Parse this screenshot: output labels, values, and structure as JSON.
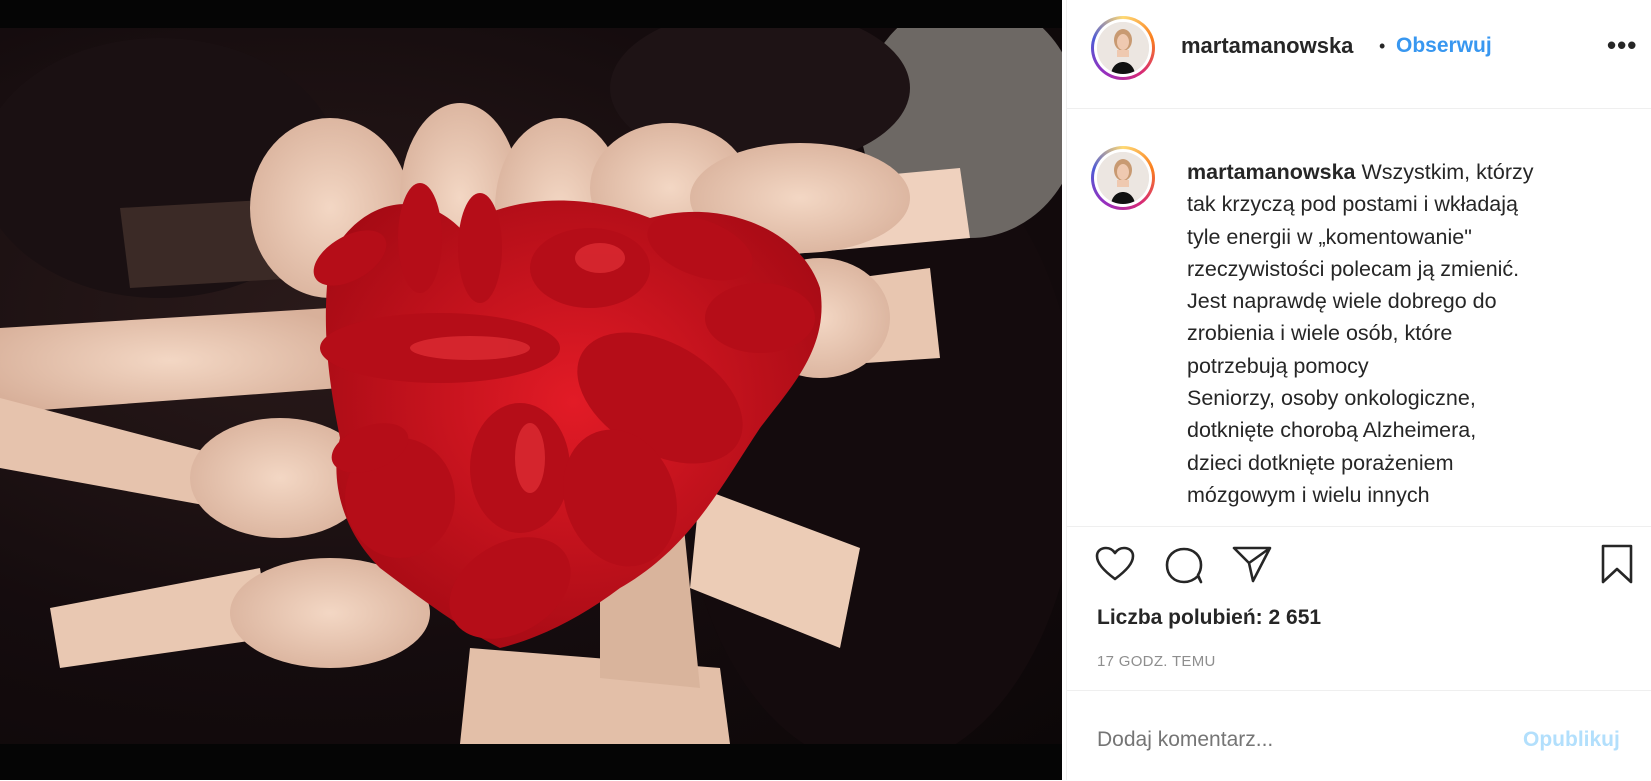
{
  "post": {
    "username": "martamanowska",
    "follow_label": "Obserwuj",
    "dot": "•",
    "more_label": "•••",
    "caption_user": "martamanowska",
    "caption_lines": [
      "Wszystkim, którzy",
      "tak krzyczą pod postami i wkładają",
      "tyle energii w „komentowanie\"",
      "rzeczywistości polecam ją zmienić.",
      "Jest naprawdę wiele dobrego do",
      "zrobienia i wiele osób, które",
      "potrzebują pomocy",
      "Seniorzy, osoby onkologiczne,",
      "dotknięte chorobą Alzheimera,",
      "dzieci dotknięte porażeniem",
      "mózgowym i wielu innych"
    ],
    "likes_text": "Liczba polubień: 2 651",
    "time_text": "17 GODZ. TEMU",
    "comment_placeholder": "Dodaj komentarz...",
    "publish_label": "Opublikuj"
  },
  "icons": {
    "like": "heart-icon",
    "comment": "speech-bubble-icon",
    "share": "paper-plane-icon",
    "save": "bookmark-icon"
  },
  "colors": {
    "link": "#3897f0",
    "text": "#262626",
    "muted": "#8e8e8e",
    "publish_disabled": "#b2dffc",
    "paint_red": "#c8101c"
  }
}
